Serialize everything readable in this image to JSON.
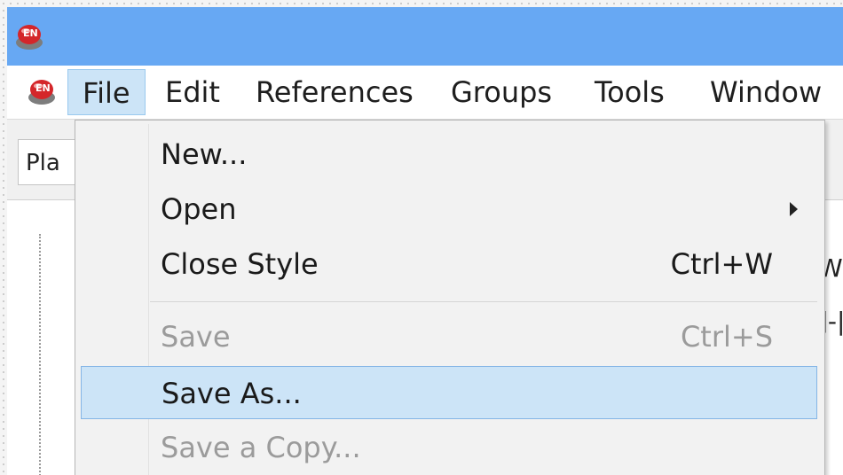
{
  "menubar": {
    "items": [
      {
        "label": "File"
      },
      {
        "label": "Edit"
      },
      {
        "label": "References"
      },
      {
        "label": "Groups"
      },
      {
        "label": "Tools"
      },
      {
        "label": "Window"
      }
    ]
  },
  "toolbar": {
    "field_text": "Pla"
  },
  "side": {
    "partial_text_1": "Wit",
    "partial_text_2": "]-|"
  },
  "file_menu": {
    "items": [
      {
        "label": "New...",
        "shortcut": ""
      },
      {
        "label": "Open",
        "shortcut": ""
      },
      {
        "label": "Close Style",
        "shortcut": "Ctrl+W"
      },
      {
        "label": "Save",
        "shortcut": "Ctrl+S"
      },
      {
        "label": "Save As...",
        "shortcut": ""
      },
      {
        "label": "Save a Copy...",
        "shortcut": ""
      }
    ]
  },
  "colors": {
    "titlebar": "#67a8f3",
    "highlight": "#cce4f7",
    "disabled_text": "#9b9b9b"
  }
}
